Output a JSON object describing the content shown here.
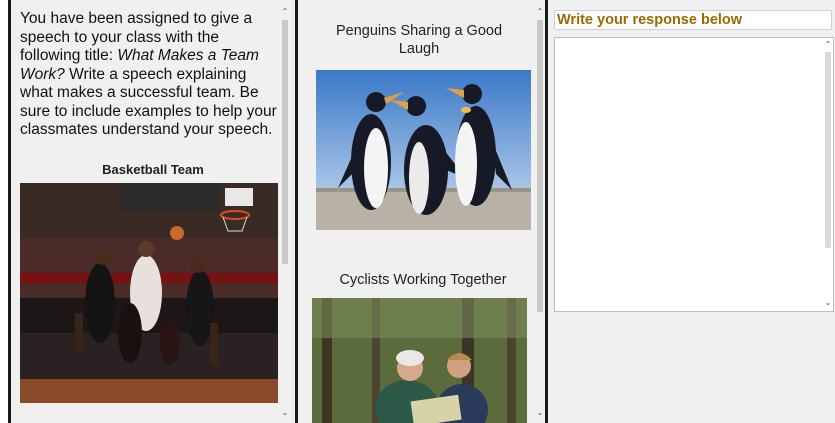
{
  "passage": {
    "prompt_part1": "You have been assigned to give a speech to your class with the following title: ",
    "prompt_title": "What Makes a Team Work?",
    "prompt_part2": "  Write a speech explaining what makes a successful team.  Be sure to include examples to help your classmates understand your speech.",
    "image1_caption": "Basketball Team"
  },
  "gallery": {
    "image2_caption": "Penguins Sharing a Good Laugh",
    "image3_caption": "Cyclists Working Together"
  },
  "response": {
    "header": "Write your response below",
    "value": ""
  },
  "icons": {
    "scroll_up": "chevron-up-icon",
    "scroll_down": "chevron-down-icon"
  },
  "colors": {
    "header_text": "#9a6a00",
    "divider": "#1a1a1a",
    "pane_bg": "#f0f0f0"
  }
}
